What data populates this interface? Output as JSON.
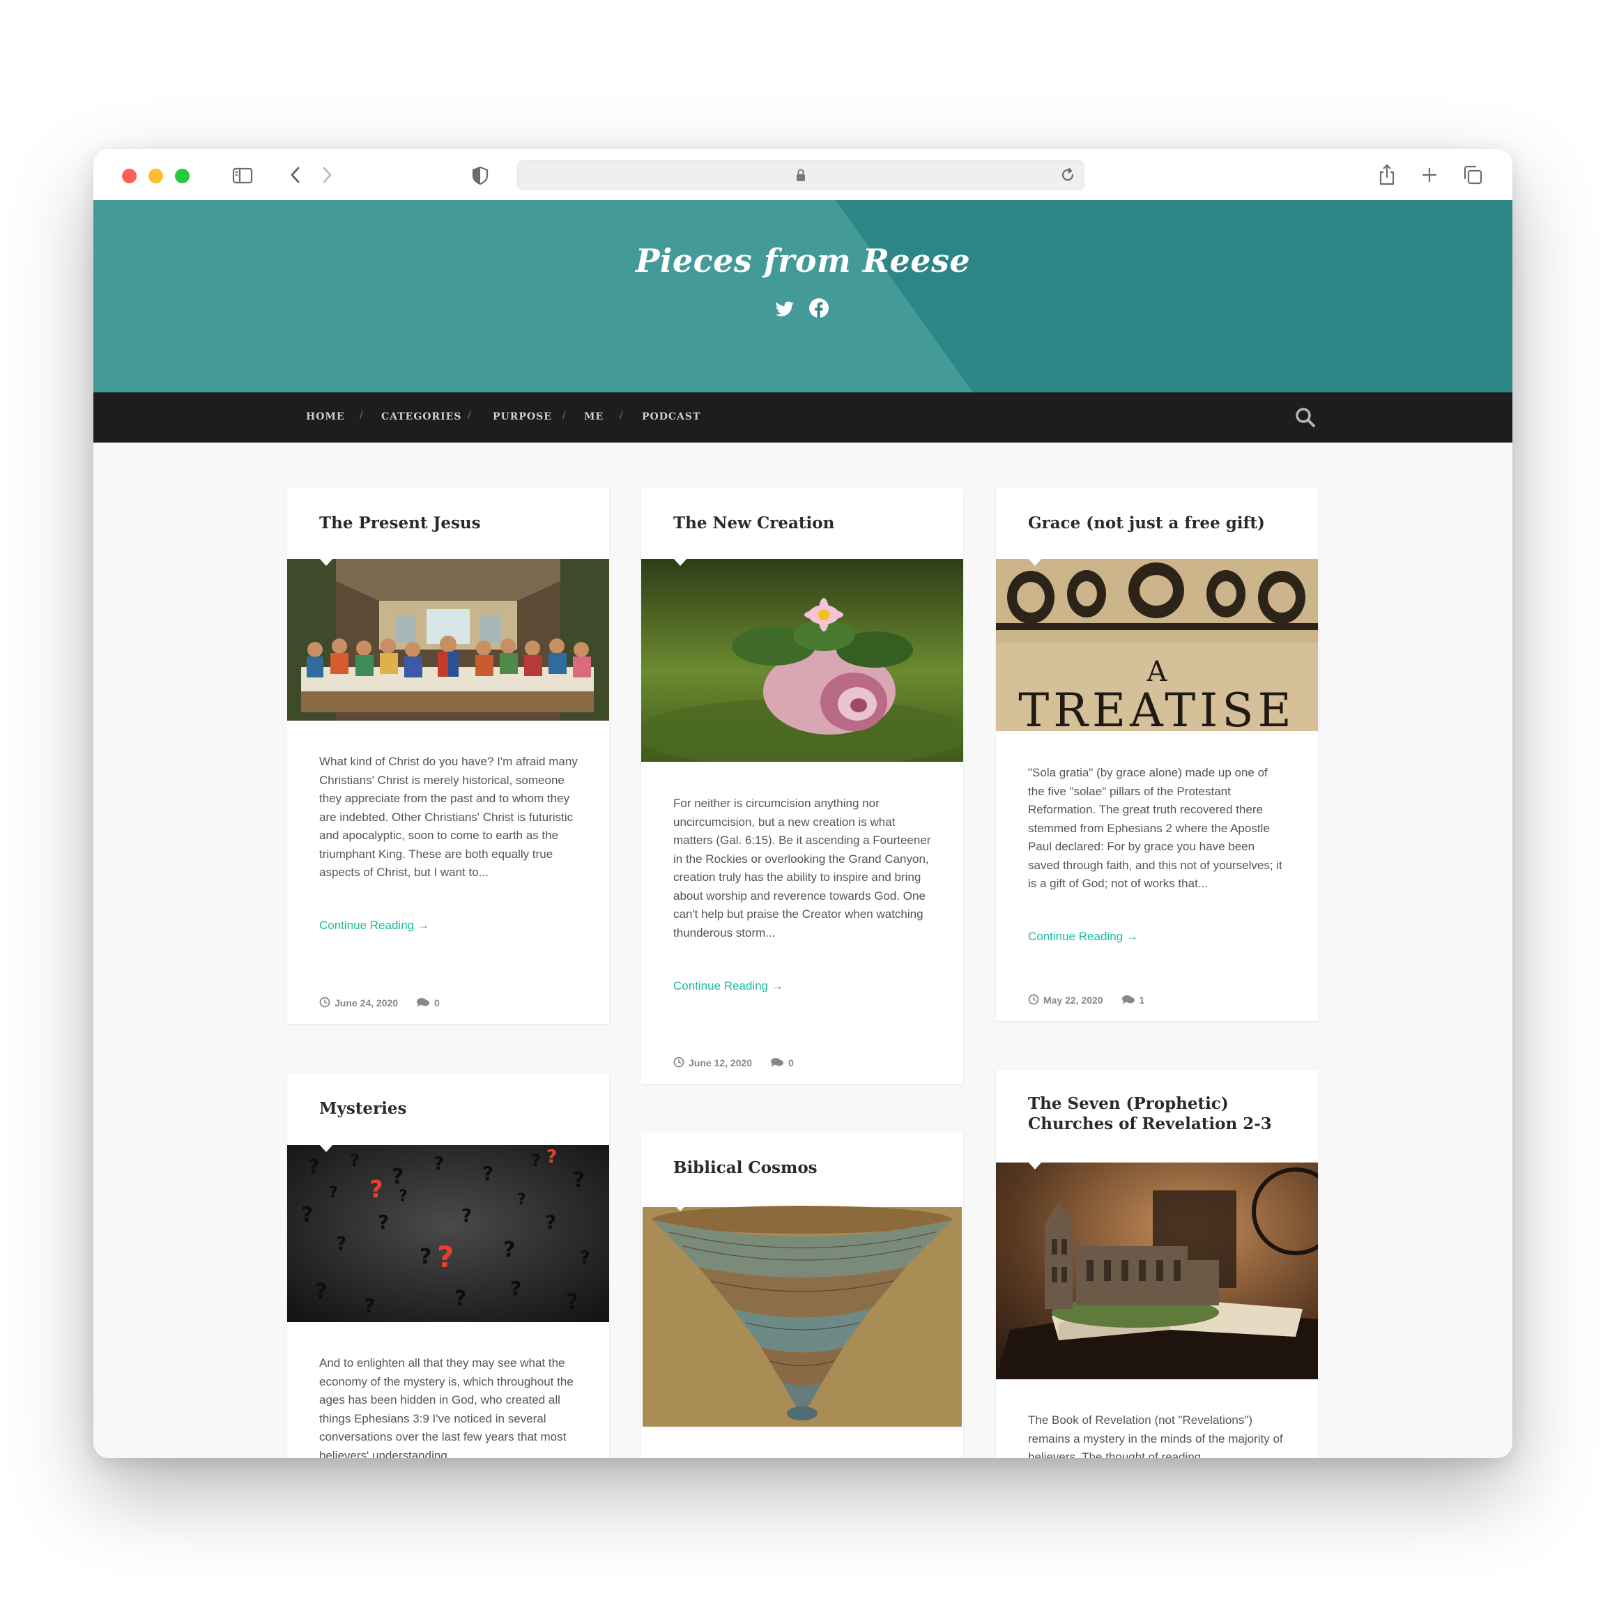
{
  "site": {
    "title": "Pieces from Reese",
    "social": [
      "twitter-icon",
      "facebook-icon"
    ]
  },
  "nav": {
    "items": [
      "HOME",
      "CATEGORIES",
      "PURPOSE",
      "ME",
      "PODCAST"
    ],
    "separator": "/"
  },
  "colors": {
    "header_teal": "#2e8585",
    "header_teal_light": "#449999",
    "nav_bg": "#1d1d1d",
    "accent": "#1abc9c"
  },
  "posts": [
    {
      "title": "The Present Jesus",
      "excerpt": "What kind of Christ do you have? I'm afraid many Christians' Christ is merely historical, someone they appreciate from the past and to whom they are indebted. Other Christians' Christ is futuristic and apocalyptic, soon to come to earth as the triumphant King. These are both equally true aspects of Christ, but I want to...",
      "more": "Continue Reading →",
      "date": "June 24, 2020",
      "comments": "0"
    },
    {
      "title": "The New Creation",
      "excerpt": "For neither is circumcision anything nor uncircumcision, but a new creation is what matters (Gal. 6:15). Be it ascending a Fourteener in the Rockies or overlooking the Grand Canyon, creation truly has the ability to inspire and bring about worship and reverence towards God. One can't help but praise the Creator when watching thunderous storm...",
      "more": "Continue Reading →",
      "date": "June 12, 2020",
      "comments": "0"
    },
    {
      "title": "Grace (not just a free gift)",
      "image_text_top": "A",
      "image_text_bottom": "TREATISE",
      "excerpt": "\"Sola gratia\" (by grace alone) made up one of the five \"solae\" pillars of the Protestant Reformation. The great truth recovered there stemmed from Ephesians 2 where the Apostle Paul declared: For by grace you have been saved through faith, and this not of yourselves; it is a gift of God; not of works that...",
      "more": "Continue Reading →",
      "date": "May 22, 2020",
      "comments": "1"
    },
    {
      "title": "Mysteries",
      "excerpt": "And to enlighten all that they may see what the economy of the mystery is, which throughout the ages has been hidden in God, who created all things Ephesians 3:9 I've noticed in several conversations over the last few years that most believers' understanding..."
    },
    {
      "title": "Biblical Cosmos"
    },
    {
      "title": "The Seven (Prophetic) Churches of Revelation 2-3",
      "excerpt": "The Book of Revelation (not \"Revelations\") remains a mystery in the minds of the majority of believers. The thought of reading..."
    }
  ]
}
